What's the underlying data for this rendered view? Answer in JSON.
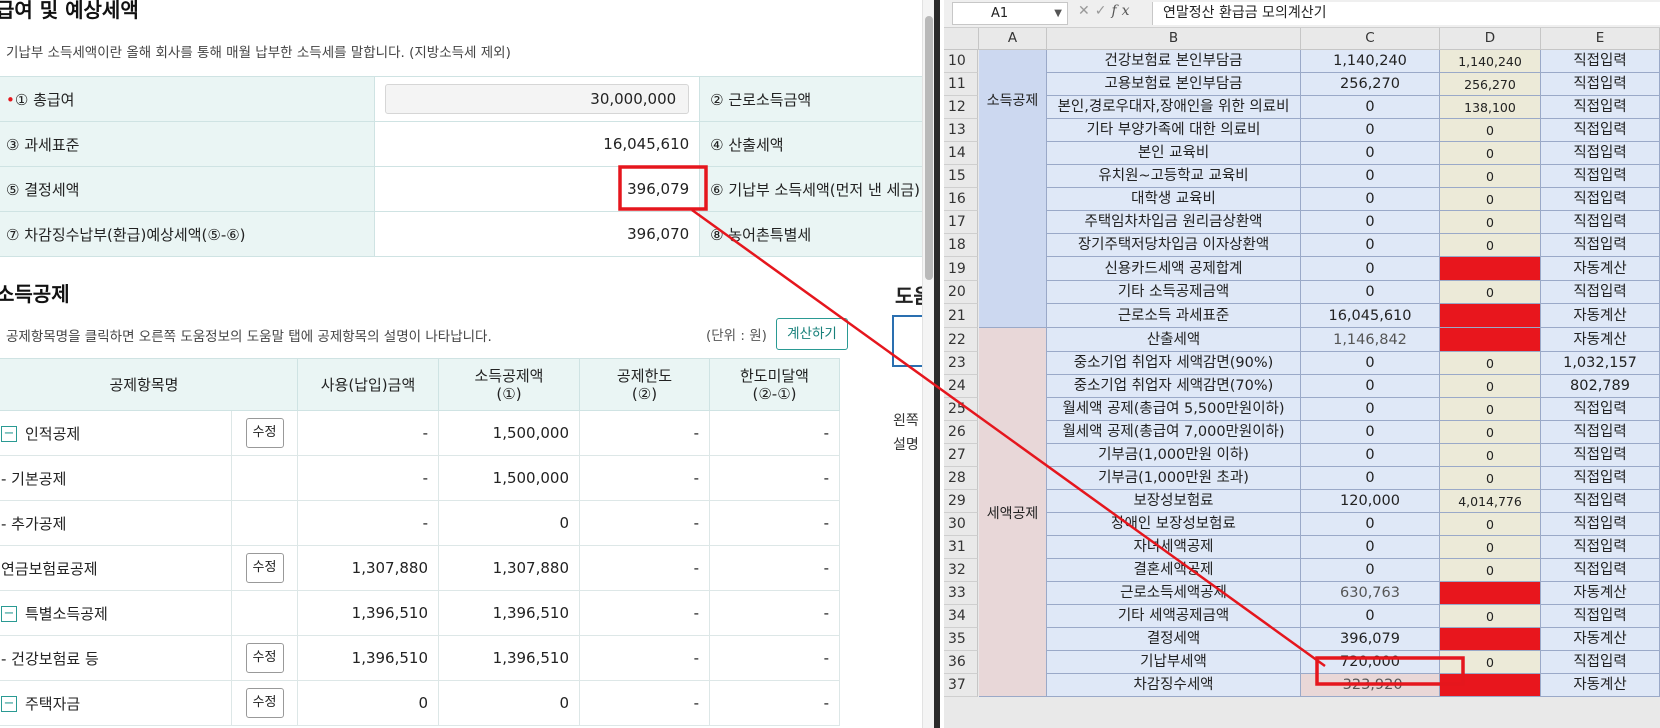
{
  "left": {
    "title_top": "급여 및 예상세액",
    "desc_top": "기납부 소득세액이란 올해 회사를 통해 매월 납부한 소득세를 말합니다. (지방소득세 제외)",
    "summary": {
      "r1": {
        "l1": "① 총급여",
        "v1": "30,000,000",
        "l2": "② 근로소득금액"
      },
      "r2": {
        "l1": "③ 과세표준",
        "v1": "16,045,610",
        "l2": "④ 산출세액"
      },
      "r3": {
        "l1": "⑤ 결정세액",
        "v1": "396,079",
        "l2": "⑥ 기납부 소득세액(먼저 낸 세금)"
      },
      "r4": {
        "l1": "⑦ 차감징수납부(환급)예상세액(⑤-⑥)",
        "v1": "396,070",
        "l2": "⑧ 농어촌특별세"
      }
    },
    "title_ded": "소득공제",
    "desc_ded": "공제항목명을 클릭하면 오른쪽 도움정보의 도움말 탭에 공제항목의 설명이 나타납니다.",
    "unit": "(단위 : 원)",
    "calc_btn": "계산하기",
    "headers": {
      "name": "공제항목명",
      "used": "사용(납입)금액",
      "ded_l1": "소득공제액",
      "ded_l2": "(①)",
      "limit_l1": "공제한도",
      "limit_l2": "(②)",
      "under_l1": "한도미달액",
      "under_l2": "(②-①)"
    },
    "rows": [
      {
        "toggle": "−",
        "name": "인적공제",
        "btn": "수정",
        "used": "-",
        "ded": "1,500,000",
        "limit": "-",
        "under": "-"
      },
      {
        "toggle": "",
        "name": "- 기본공제",
        "btn": "",
        "used": "-",
        "ded": "1,500,000",
        "limit": "-",
        "under": "-"
      },
      {
        "toggle": "",
        "name": "- 추가공제",
        "btn": "",
        "used": "-",
        "ded": "0",
        "limit": "-",
        "under": "-"
      },
      {
        "toggle": "",
        "name": "연금보험료공제",
        "btn": "수정",
        "used": "1,307,880",
        "ded": "1,307,880",
        "limit": "-",
        "under": "-"
      },
      {
        "toggle": "−",
        "name": "특별소득공제",
        "btn": "",
        "used": "1,396,510",
        "ded": "1,396,510",
        "limit": "-",
        "under": "-"
      },
      {
        "toggle": "",
        "name": "- 건강보험료 등",
        "btn": "수정",
        "used": "1,396,510",
        "ded": "1,396,510",
        "limit": "-",
        "under": "-"
      },
      {
        "toggle": "−",
        "name": "주택자금",
        "btn": "수정",
        "used": "0",
        "ded": "0",
        "limit": "-",
        "under": "-"
      }
    ],
    "help_title": "도움",
    "help_line1": "왼쪽",
    "help_line2": "설명"
  },
  "sheet": {
    "namebox": "A1",
    "formula": "연말정산 환급금 모의계산기",
    "cols": [
      "A",
      "B",
      "C",
      "D",
      "E"
    ],
    "group1": "소득공제",
    "group2": "세액공제",
    "rows": [
      {
        "n": "10",
        "b": "건강보험료 본인부담금",
        "c": "1,140,240",
        "d": "1,140,240",
        "e": "직접입력",
        "red": false
      },
      {
        "n": "11",
        "b": "고용보험료 본인부담금",
        "c": "256,270",
        "d": "256,270",
        "e": "직접입력",
        "red": false
      },
      {
        "n": "12",
        "b": "본인,경로우대자,장애인을 위한 의료비",
        "c": "0",
        "d": "138,100",
        "e": "직접입력",
        "red": false
      },
      {
        "n": "13",
        "b": "기타 부양가족에 대한 의료비",
        "c": "0",
        "d": "0",
        "e": "직접입력",
        "red": false
      },
      {
        "n": "14",
        "b": "본인 교육비",
        "c": "0",
        "d": "0",
        "e": "직접입력",
        "red": false
      },
      {
        "n": "15",
        "b": "유치원~고등학교 교육비",
        "c": "0",
        "d": "0",
        "e": "직접입력",
        "red": false
      },
      {
        "n": "16",
        "b": "대학생 교육비",
        "c": "0",
        "d": "0",
        "e": "직접입력",
        "red": false
      },
      {
        "n": "17",
        "b": "주택임차차입금 원리금상환액",
        "c": "0",
        "d": "0",
        "e": "직접입력",
        "red": false
      },
      {
        "n": "18",
        "b": "장기주택저당차입금 이자상환액",
        "c": "0",
        "d": "0",
        "e": "직접입력",
        "red": false
      },
      {
        "n": "19",
        "b": "신용카드세액 공제합계",
        "c": "0",
        "d": "",
        "e": "자동계산",
        "red": true
      },
      {
        "n": "20",
        "b": "기타 소득공제금액",
        "c": "0",
        "d": "0",
        "e": "직접입력",
        "red": false
      },
      {
        "n": "21",
        "b": "근로소득 과세표준",
        "c": "16,045,610",
        "d": "",
        "e": "자동계산",
        "red": true
      },
      {
        "n": "22",
        "b": "산출세액",
        "c": "1,146,842",
        "d": "",
        "e": "자동계산",
        "red": true
      },
      {
        "n": "23",
        "b": "중소기업 취업자 세액감면(90%)",
        "c": "0",
        "d": "0",
        "e": "1,032,157",
        "red": false
      },
      {
        "n": "24",
        "b": "중소기업 취업자 세액감면(70%)",
        "c": "0",
        "d": "0",
        "e": "802,789",
        "red": false
      },
      {
        "n": "25",
        "b": "월세액 공제(총급여 5,500만원이하)",
        "c": "0",
        "d": "0",
        "e": "직접입력",
        "red": false
      },
      {
        "n": "26",
        "b": "월세액 공제(총급여 7,000만원이하)",
        "c": "0",
        "d": "0",
        "e": "직접입력",
        "red": false
      },
      {
        "n": "27",
        "b": "기부금(1,000만원 이하)",
        "c": "0",
        "d": "0",
        "e": "직접입력",
        "red": false
      },
      {
        "n": "28",
        "b": "기부금(1,000만원 초과)",
        "c": "0",
        "d": "0",
        "e": "직접입력",
        "red": false
      },
      {
        "n": "29",
        "b": "보장성보험료",
        "c": "120,000",
        "d": "4,014,776",
        "e": "직접입력",
        "red": false
      },
      {
        "n": "30",
        "b": "장애인 보장성보험료",
        "c": "0",
        "d": "0",
        "e": "직접입력",
        "red": false
      },
      {
        "n": "31",
        "b": "자녀세액공제",
        "c": "0",
        "d": "0",
        "e": "직접입력",
        "red": false
      },
      {
        "n": "32",
        "b": "결혼세액공제",
        "c": "0",
        "d": "0",
        "e": "직접입력",
        "red": false
      },
      {
        "n": "33",
        "b": "근로소득세액공제",
        "c": "630,763",
        "d": "",
        "e": "자동계산",
        "red": true
      },
      {
        "n": "34",
        "b": "기타 세액공제금액",
        "c": "0",
        "d": "0",
        "e": "직접입력",
        "red": false
      },
      {
        "n": "35",
        "b": "결정세액",
        "c": "396,079",
        "d": "",
        "e": "자동계산",
        "red": true
      },
      {
        "n": "36",
        "b": "기납부세액",
        "c": "720,000",
        "d": "0",
        "e": "직접입력",
        "red": false
      },
      {
        "n": "37",
        "b": "차감징수세액",
        "c": "-323,920",
        "d": "",
        "e": "자동계산",
        "red": true
      }
    ],
    "grey_rows": [
      "22",
      "33",
      "37"
    ]
  },
  "colors": {
    "highlight": "#e5161d",
    "teal": "#2a9a93",
    "sheet_blue": "#dfe8f7",
    "sheet_red": "#e8161d"
  }
}
